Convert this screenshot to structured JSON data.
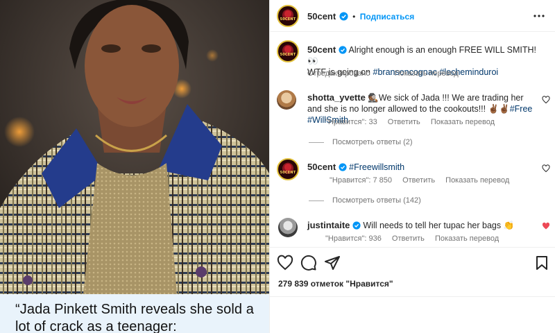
{
  "media": {
    "caption": "“Jada Pinkett Smith reveals she sold a lot of crack as a teenager:"
  },
  "header": {
    "username": "50cent",
    "follow_label": "Подписаться",
    "avatar_text": "50CENT"
  },
  "post": {
    "username": "50cent",
    "caption_main": "Alright enough is an enough FREE WILL SMITH! 👀",
    "caption_line2_prefix": "WTF is going on",
    "hashtag1": "#bransoncognac",
    "hashtag2": "#lecheminduroi",
    "edited_label": "Отредактировано",
    "translate_label": "Показать перевод"
  },
  "comments": [
    {
      "username": "shotta_yvette",
      "text_part1": "🕵🏾We sick of Jada !!! We are trading her and she is no longer allowed to the cookouts!!! ✌🏾✌🏾",
      "hashtag1": "#Free",
      "hashtag2": "#WillSmith",
      "likes_label": "\"Нравится\": 33",
      "reply_label": "Ответить",
      "translate_label": "Показать перевод",
      "view_replies": "Посмотреть ответы (2)",
      "liked": false
    },
    {
      "username": "50cent",
      "hashtag1": "#Freewillsmith",
      "likes_label": "\"Нравится\": 7 850",
      "reply_label": "Ответить",
      "translate_label": "Показать перевод",
      "view_replies": "Посмотреть ответы (142)",
      "liked": false
    },
    {
      "username": "justintaite",
      "text": "Will needs to tell her tupac her bags 👏",
      "likes_label": "\"Нравится\": 936",
      "reply_label": "Ответить",
      "translate_label": "Показать перевод",
      "liked": true
    }
  ],
  "actions": {
    "likes_count": "279 839 отметок \"Нравится\""
  },
  "colors": {
    "link_blue": "#0095f6",
    "hashtag": "#00376b",
    "verified": "#0095f6",
    "liked_red": "#ed4956"
  }
}
